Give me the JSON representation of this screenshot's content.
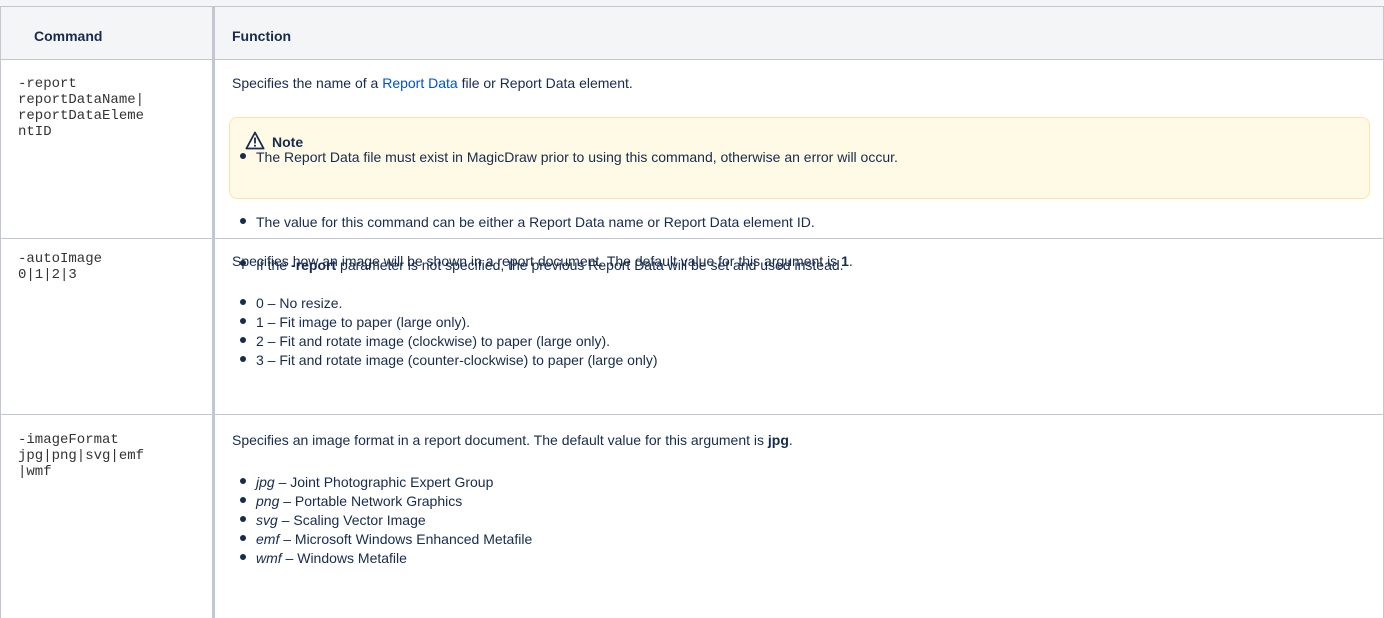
{
  "table": {
    "headers": {
      "command": "Command",
      "function": "Function"
    },
    "rows": [
      {
        "command": "-report\nreportDataName|\nreportDataEleme\nntID",
        "description_pre": "Specifies the name of a ",
        "description_link": "Report Data",
        "description_post": " file or Report Data element.",
        "note": {
          "title": "Note",
          "icon": "warning-icon",
          "items": [
            "The Report Data file must exist in MagicDraw prior to using this command, otherwise an error will occur.",
            "The value for this command can be either a Report Data name or Report Data element ID."
          ],
          "overflow_item_pre": "If the ",
          "overflow_item_bold": "-report",
          "overflow_item_post": " parameter is not specified, the previous Report Data will be set and used instead."
        }
      },
      {
        "command": "-autoImage\n0|1|2|3",
        "description_pre": "Specifies how an image will be shown in a report document. The default value for this argument is ",
        "description_bold": "1",
        "description_post": ".",
        "items": [
          "0 – No resize.",
          "1 – Fit image to paper (large only).",
          "2 – Fit and rotate image (clockwise) to paper (large only).",
          "3 – Fit and rotate image (counter-clockwise) to paper (large only)"
        ]
      },
      {
        "command": "-imageFormat\njpg|png|svg|emf\n|wmf",
        "description_pre": "Specifies an image format in a report document. The default value for this argument is ",
        "description_bold": "jpg",
        "description_post": ".",
        "items": [
          {
            "term": "jpg",
            "desc": " – Joint Photographic Expert Group"
          },
          {
            "term": "png",
            "desc": " – Portable Network Graphics"
          },
          {
            "term": "svg",
            "desc": " – Scaling Vector Image"
          },
          {
            "term": "emf",
            "desc": " – Microsoft Windows Enhanced Metafile"
          },
          {
            "term": "wmf",
            "desc": " – Windows Metafile"
          }
        ]
      }
    ]
  },
  "colors": {
    "header_bg": "#f4f5f7",
    "border": "#c1c7d0",
    "link": "#0052cc",
    "note_bg": "#fffae6",
    "note_border": "#ffe3a3"
  }
}
